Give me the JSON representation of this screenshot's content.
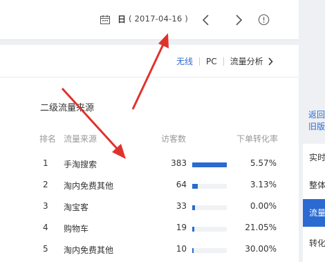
{
  "toolbar": {
    "calendar_icon": "calendar-icon",
    "date_label": "日",
    "date_value": "( 2017-04-16 )",
    "prev_icon": "chevron-left-icon",
    "next_icon": "chevron-right-icon",
    "info_icon": "info-icon"
  },
  "tabs": {
    "wireless": "无线",
    "pc": "PC",
    "analysis": "流量分析"
  },
  "section": {
    "title": "二级流量来源"
  },
  "table": {
    "headers": {
      "rank": "排名",
      "source": "流量来源",
      "visitors": "访客数",
      "conversion": "下单转化率"
    },
    "rows": [
      {
        "rank": "1",
        "source": "手淘搜索",
        "visitors": "383",
        "conversion": "5.57%",
        "bar_fraction": 1.0
      },
      {
        "rank": "2",
        "source": "淘内免费其他",
        "visitors": "64",
        "conversion": "3.13%",
        "bar_fraction": 0.167
      },
      {
        "rank": "3",
        "source": "淘宝客",
        "visitors": "33",
        "conversion": "0.00%",
        "bar_fraction": 0.086
      },
      {
        "rank": "4",
        "source": "购物车",
        "visitors": "19",
        "conversion": "21.05%",
        "bar_fraction": 0.05
      },
      {
        "rank": "5",
        "source": "淘内免费其他",
        "visitors": "10",
        "conversion": "30.00%",
        "bar_fraction": 0.026
      }
    ]
  },
  "sidebar": {
    "back_link": "返回旧版",
    "items": [
      {
        "label": "实时"
      },
      {
        "label": "整体"
      },
      {
        "label": "流量",
        "active": true
      },
      {
        "label": "转化"
      }
    ]
  },
  "colors": {
    "accent": "#2b6ad1",
    "annotation_arrow": "#e0322d"
  }
}
